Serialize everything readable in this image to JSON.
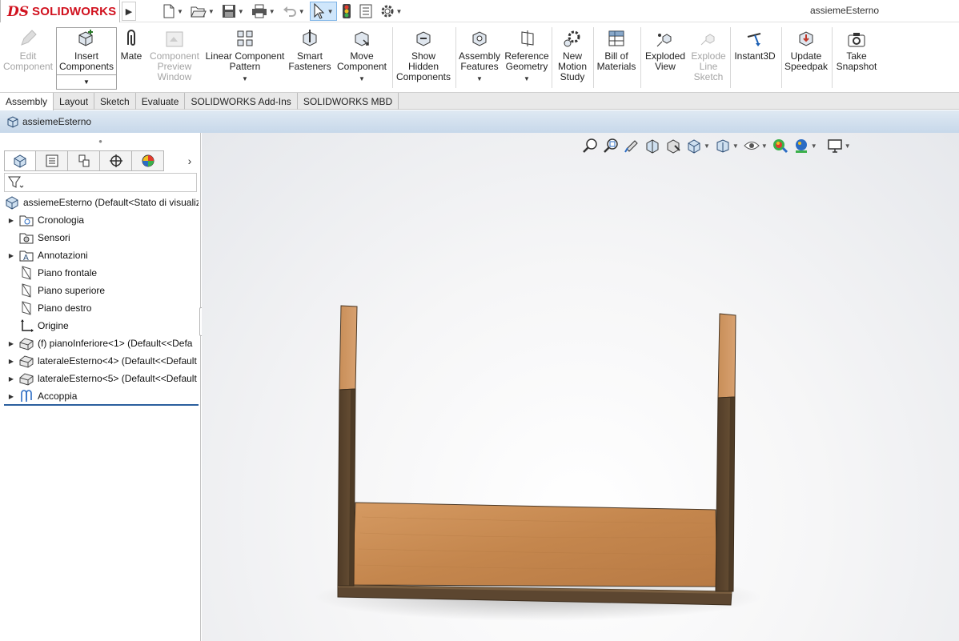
{
  "app": {
    "brand_prefix": "DS",
    "brand_name": "SOLIDWORKS",
    "document_title": "assiemeEsterno"
  },
  "quick_access": [
    {
      "icon": "new-document-icon"
    },
    {
      "icon": "open-folder-icon"
    },
    {
      "icon": "save-icon"
    },
    {
      "icon": "print-icon"
    },
    {
      "icon": "undo-icon"
    },
    {
      "icon": "select-arrow-icon"
    },
    {
      "icon": "rebuild-traffic-light-icon"
    },
    {
      "icon": "file-properties-icon"
    },
    {
      "icon": "options-gear-icon"
    }
  ],
  "ribbon": {
    "edit_component": "Edit\nComponent",
    "insert_components": "Insert\nComponents",
    "mate": "Mate",
    "component_preview": "Component\nPreview\nWindow",
    "linear_pattern": "Linear Component\nPattern",
    "smart_fasteners": "Smart\nFasteners",
    "move_component": "Move\nComponent",
    "show_hidden": "Show\nHidden\nComponents",
    "assembly_features": "Assembly\nFeatures",
    "reference_geometry": "Reference\nGeometry",
    "motion_study": "New\nMotion\nStudy",
    "bill_of_materials": "Bill of\nMaterials",
    "exploded_view": "Exploded\nView",
    "explode_line_sketch": "Explode\nLine\nSketch",
    "instant3d": "Instant3D",
    "update_speedpak": "Update\nSpeedpak",
    "take_snapshot": "Take\nSnapshot"
  },
  "tabs": [
    "Assembly",
    "Layout",
    "Sketch",
    "Evaluate",
    "SOLIDWORKS Add-Ins",
    "SOLIDWORKS MBD"
  ],
  "active_tab": "Assembly",
  "breadcrumb": {
    "label": "assiemeEsterno"
  },
  "tree": {
    "root": "assiemeEsterno  (Default<Stato di visualiz",
    "items": [
      {
        "label": "Cronologia",
        "expandable": true,
        "icon": "history-folder-icon"
      },
      {
        "label": "Sensori",
        "expandable": false,
        "icon": "sensor-icon"
      },
      {
        "label": "Annotazioni",
        "expandable": true,
        "icon": "annotation-icon"
      },
      {
        "label": "Piano frontale",
        "expandable": false,
        "icon": "plane-icon"
      },
      {
        "label": "Piano superiore",
        "expandable": false,
        "icon": "plane-icon"
      },
      {
        "label": "Piano destro",
        "expandable": false,
        "icon": "plane-icon"
      },
      {
        "label": "Origine",
        "expandable": false,
        "icon": "origin-icon"
      },
      {
        "label": "(f) pianoInferiore<1>  (Default<<Defa",
        "expandable": true,
        "icon": "part-icon"
      },
      {
        "label": "lateraleEsterno<4>  (Default<<Default",
        "expandable": true,
        "icon": "part-icon"
      },
      {
        "label": "lateraleEsterno<5>  (Default<<Default",
        "expandable": true,
        "icon": "part-icon"
      },
      {
        "label": "Accoppia",
        "expandable": true,
        "icon": "mates-icon"
      }
    ]
  },
  "heads_up_toolbar": [
    "zoom-to-fit-icon",
    "zoom-to-area-icon",
    "previous-view-icon",
    "section-view-icon",
    "dynamic-annotation-icon",
    "view-orientation-icon",
    "display-style-icon",
    "hide-show-items-icon",
    "edit-appearance-icon",
    "apply-scene-icon",
    "view-settings-icon"
  ],
  "colors": {
    "brand_red": "#d1121f",
    "wood_light": "#c98a52",
    "wood_dark": "#5c4630",
    "selection_blue": "#2b5f9e"
  }
}
